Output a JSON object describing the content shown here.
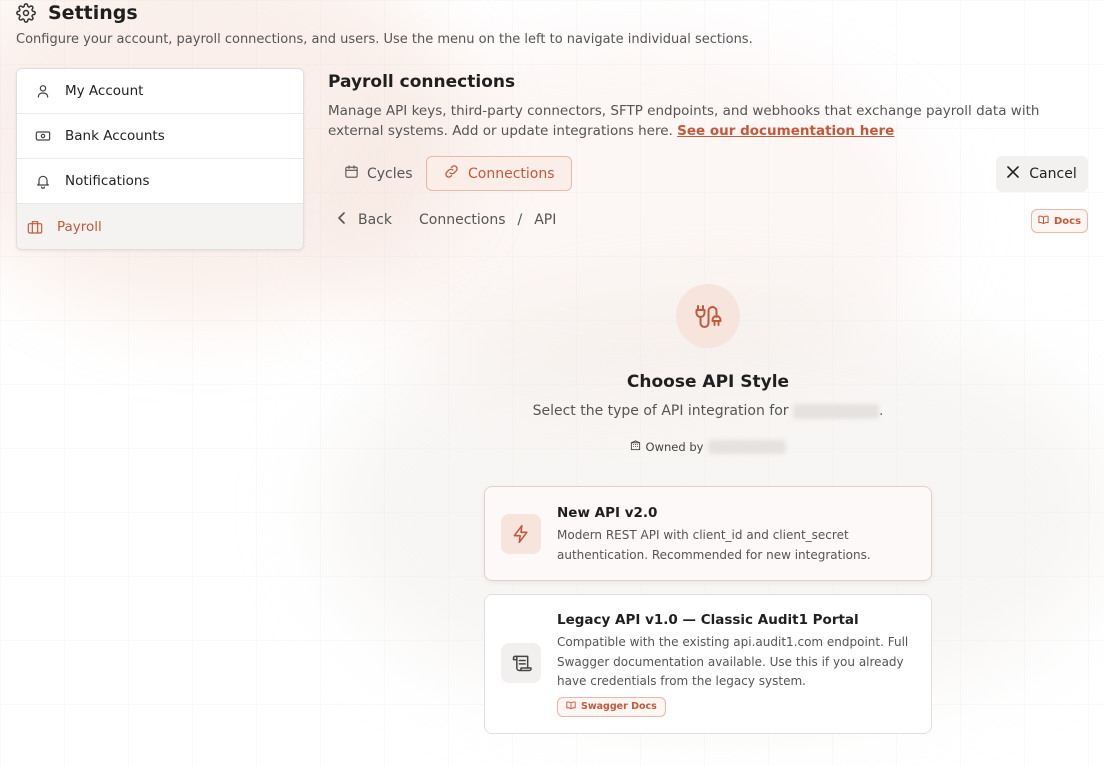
{
  "header": {
    "title": "Settings",
    "subtitle": "Configure your account, payroll connections, and users. Use the menu on the left to navigate individual sections."
  },
  "sidebar": {
    "items": [
      {
        "label": "My Account",
        "icon": "user-icon"
      },
      {
        "label": "Bank Accounts",
        "icon": "banknote-icon"
      },
      {
        "label": "Notifications",
        "icon": "bell-icon"
      },
      {
        "label": "Payroll",
        "icon": "briefcase-icon",
        "active": true
      }
    ]
  },
  "main": {
    "title": "Payroll connections",
    "description": "Manage API keys, third-party connectors, SFTP endpoints, and webhooks that exchange payroll data with external systems. Add or update integrations here.",
    "doc_link": "See our documentation here",
    "tabs": [
      {
        "label": "Cycles",
        "icon": "calendar-icon"
      },
      {
        "label": "Connections",
        "icon": "link-icon",
        "active": true
      }
    ],
    "cancel_label": "Cancel",
    "back_label": "Back",
    "breadcrumb": [
      "Connections",
      "/",
      "API"
    ],
    "docs_label": "Docs"
  },
  "chooser": {
    "title": "Choose API Style",
    "subtitle_prefix": "Select the type of API integration for",
    "subtitle_suffix": ".",
    "owned_by_label": "Owned by"
  },
  "options": [
    {
      "title": "New API v2.0",
      "description": "Modern REST API with client_id and client_secret authentication. Recommended for new integrations.",
      "icon": "lightning-icon"
    },
    {
      "title": "Legacy API v1.0 — Classic Audit1 Portal",
      "description": "Compatible with the existing api.audit1.com endpoint. Full Swagger documentation available. Use this if you already have credentials from the legacy system.",
      "icon": "scroll-icon",
      "badge": "Swagger Docs"
    }
  ],
  "colors": {
    "accent": "#c4593a",
    "accent_soft": "#f6e4dd"
  }
}
